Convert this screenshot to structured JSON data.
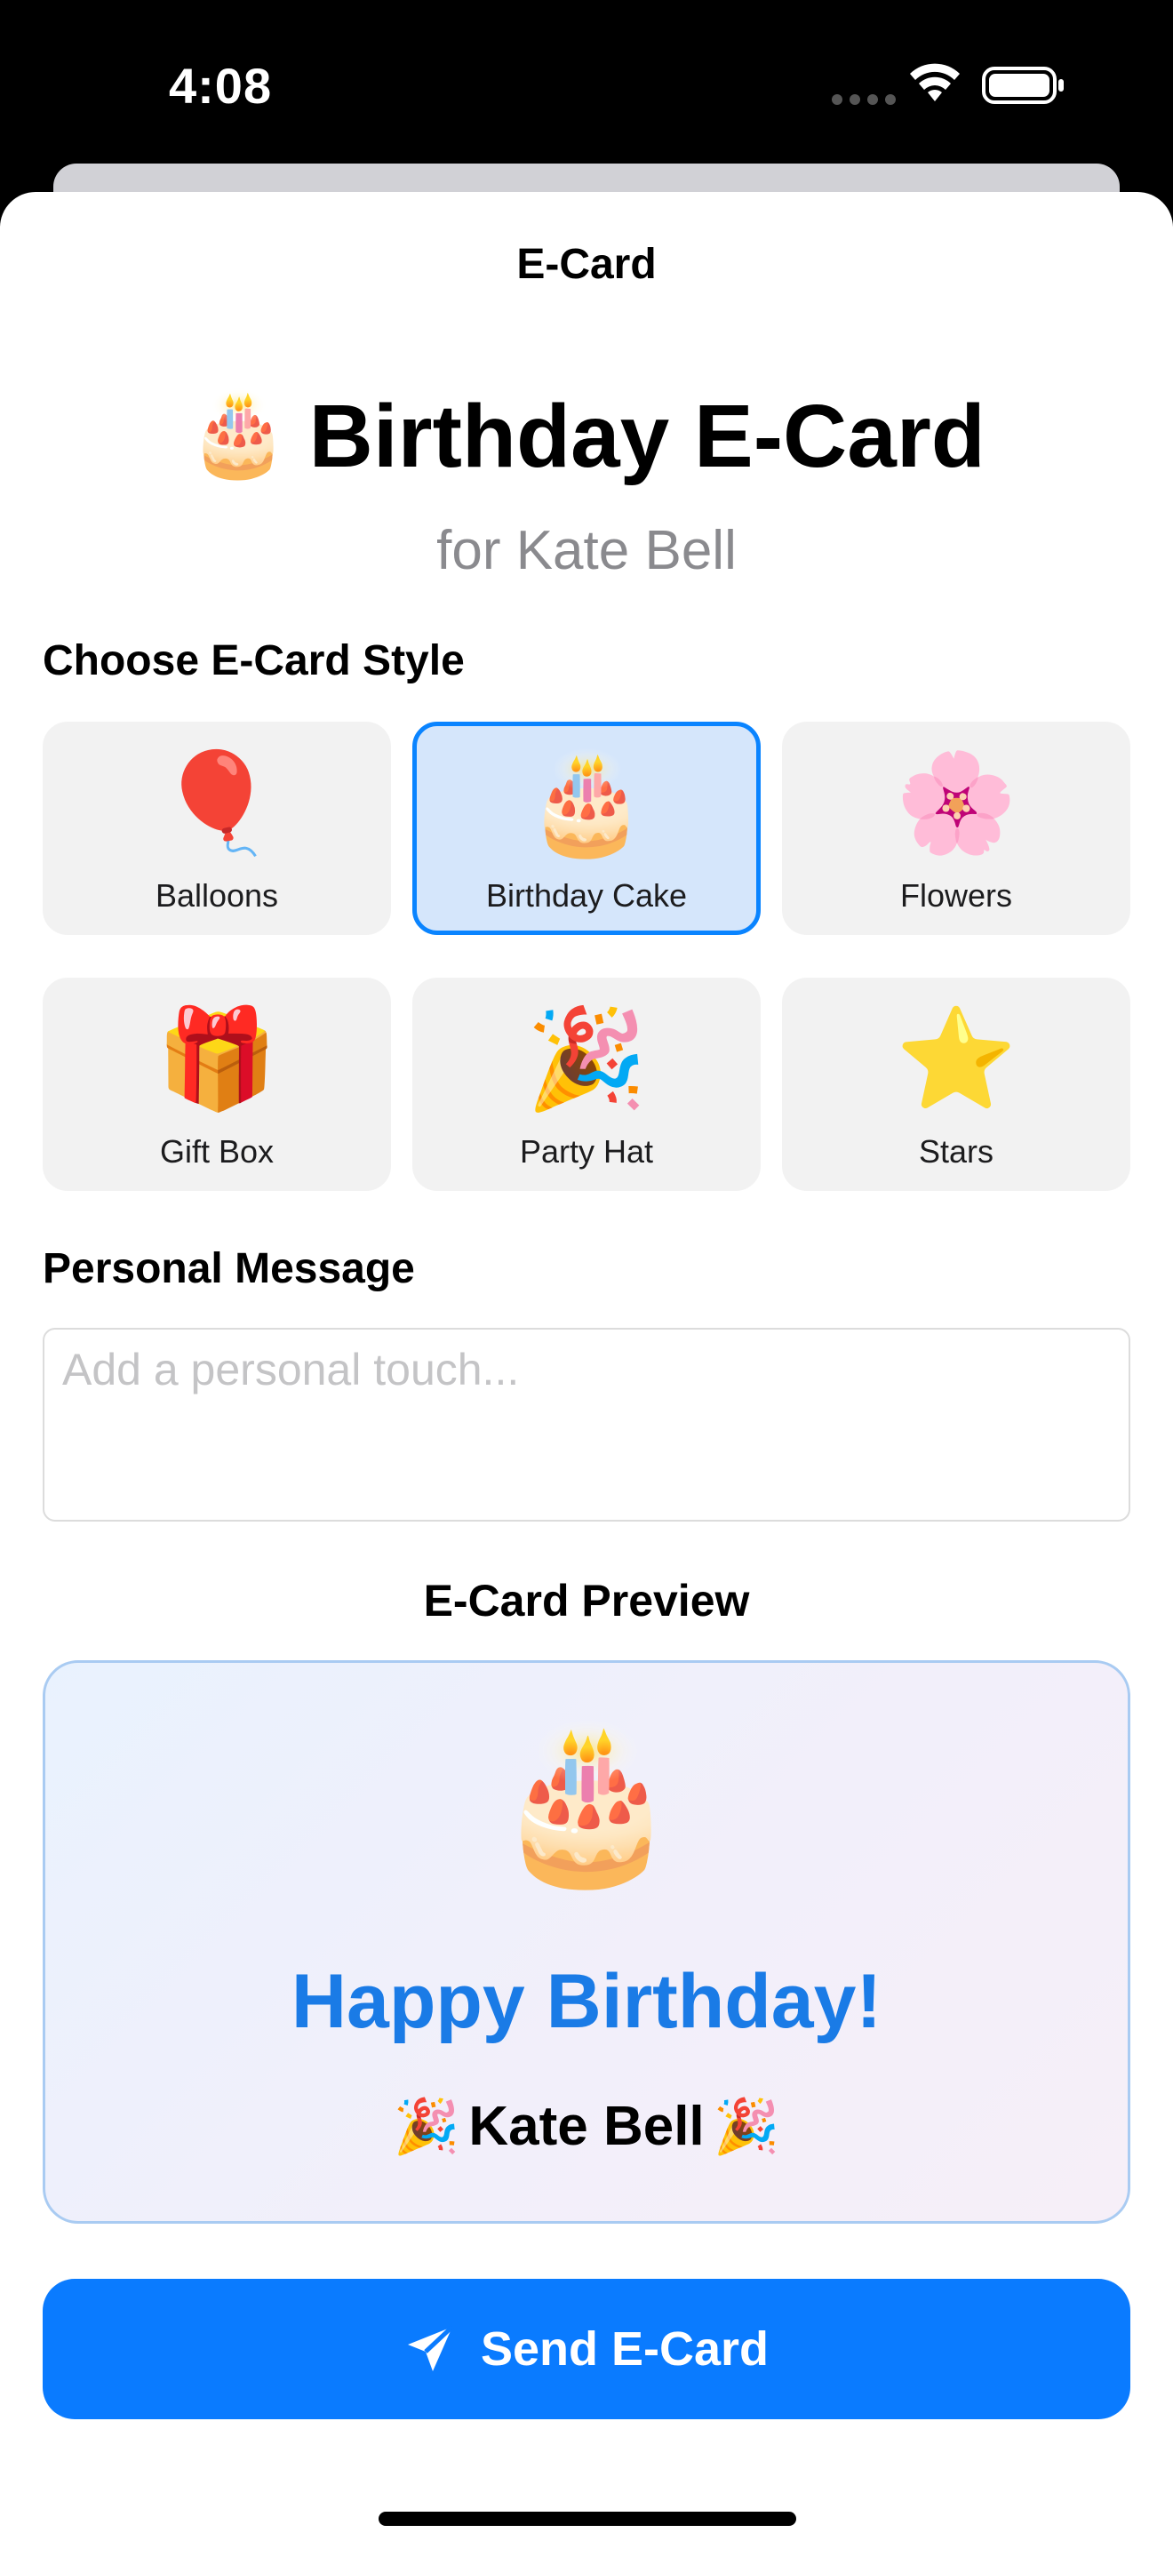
{
  "status_bar": {
    "time": "4:08",
    "wifi_icon": "wifi-icon",
    "battery_icon": "battery-icon"
  },
  "nav": {
    "title": "E-Card"
  },
  "hero": {
    "emoji": "🎂",
    "title": "Birthday E-Card",
    "subtitle": "for Kate Bell"
  },
  "style_section": {
    "label": "Choose E-Card Style",
    "selected_index": 1,
    "options": [
      {
        "emoji": "🎈",
        "label": "Balloons"
      },
      {
        "emoji": "🎂",
        "label": "Birthday Cake"
      },
      {
        "emoji": "🌸",
        "label": "Flowers"
      },
      {
        "emoji": "🎁",
        "label": "Gift Box"
      },
      {
        "emoji": "🎉",
        "label": "Party Hat"
      },
      {
        "emoji": "⭐",
        "label": "Stars"
      }
    ]
  },
  "message_section": {
    "label": "Personal Message",
    "value": "",
    "placeholder": "Add a personal touch..."
  },
  "preview": {
    "label": "E-Card Preview",
    "emoji": "🎂",
    "heading": "Happy Birthday!",
    "name_prefix_emoji": "🎉",
    "name": "Kate Bell",
    "name_suffix_emoji": "🎉"
  },
  "send_button": {
    "label": "Send E-Card",
    "icon": "paper-plane-icon"
  },
  "colors": {
    "accent": "#0A7BFF",
    "heading_blue": "#1A7BE6",
    "selected_card_bg": "#D5E6FB",
    "card_bg": "#F2F2F2"
  }
}
